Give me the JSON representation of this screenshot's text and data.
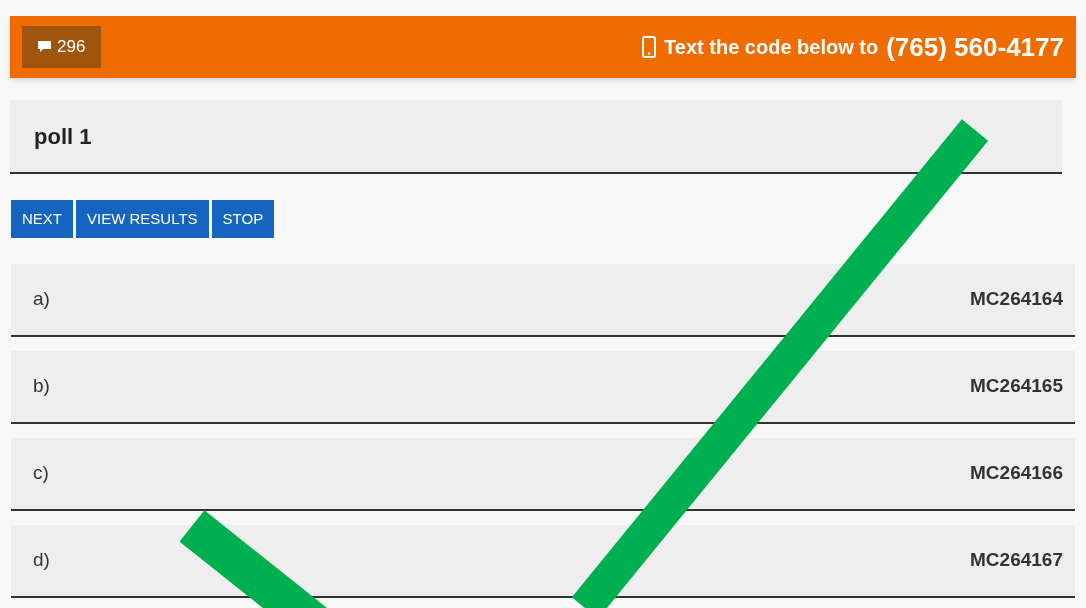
{
  "header": {
    "count": "296",
    "instruction": "Text the code below to",
    "phone": "(765) 560-4177"
  },
  "poll": {
    "title": "poll 1"
  },
  "buttons": [
    "NEXT",
    "VIEW RESULTS",
    "STOP"
  ],
  "options": [
    {
      "label": "a)",
      "code": "MC264164"
    },
    {
      "label": "b)",
      "code": "MC264165"
    },
    {
      "label": "c)",
      "code": "MC264166"
    },
    {
      "label": "d)",
      "code": "MC264167"
    }
  ]
}
